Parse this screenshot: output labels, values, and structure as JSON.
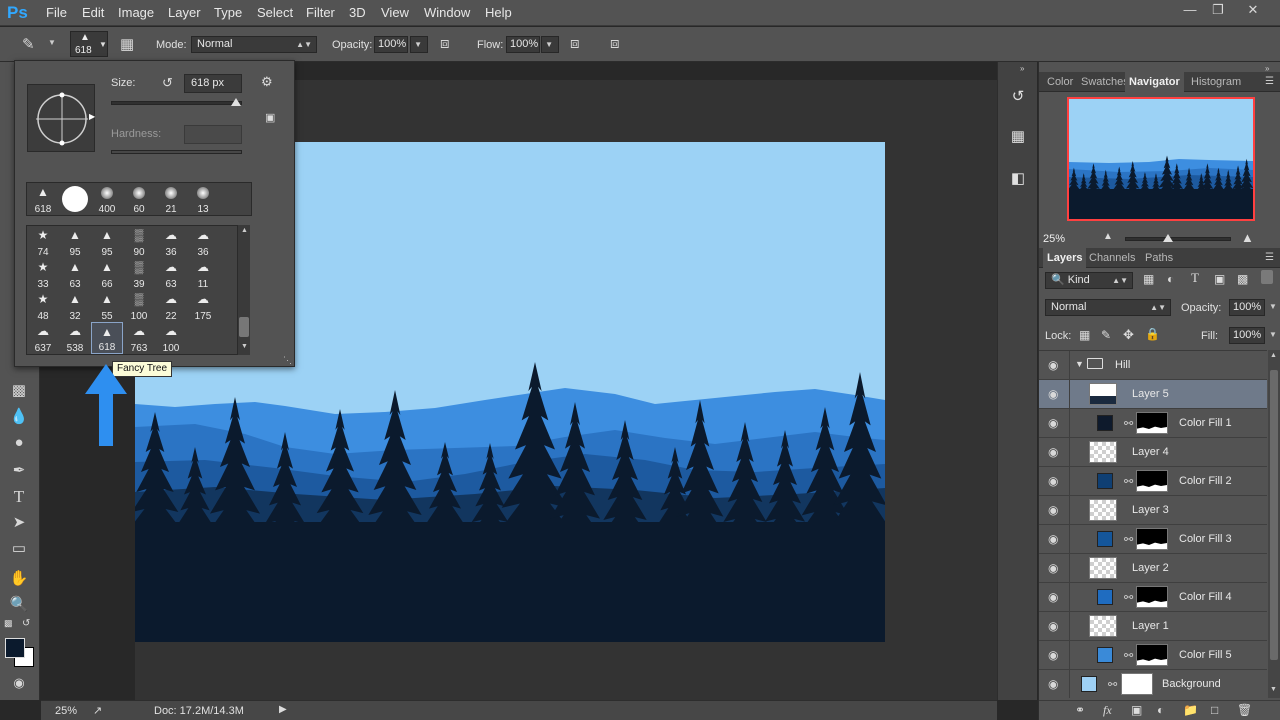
{
  "app": {
    "logo": "Ps",
    "menu": [
      "File",
      "Edit",
      "Image",
      "Layer",
      "Type",
      "Select",
      "Filter",
      "3D",
      "View",
      "Window",
      "Help"
    ],
    "window_controls": [
      "minimize",
      "restore",
      "close"
    ]
  },
  "options_bar": {
    "brush_size": "618",
    "mode_label": "Mode:",
    "mode_value": "Normal",
    "opacity_label": "Opacity:",
    "opacity_value": "100%",
    "flow_label": "Flow:",
    "flow_value": "100%"
  },
  "brush_picker": {
    "size_label": "Size:",
    "size_value": "618 px",
    "hardness_label": "Hardness:",
    "size_slider_level": 0.95,
    "recent_presets": [
      {
        "icon": "tree-brush-icon",
        "size": "618"
      },
      {
        "icon": "hard-round-brush-icon",
        "size": ""
      },
      {
        "icon": "soft-round-brush-icon",
        "size": "400"
      },
      {
        "icon": "soft-round-brush-icon",
        "size": "60"
      },
      {
        "icon": "soft-round-brush-icon",
        "size": "21"
      },
      {
        "icon": "soft-round-brush-icon",
        "size": "13"
      }
    ],
    "grid": [
      [
        "74",
        "95",
        "95",
        "90",
        "36",
        "36"
      ],
      [
        "33",
        "63",
        "66",
        "39",
        "63",
        "11"
      ],
      [
        "48",
        "32",
        "55",
        "100",
        "22",
        "175"
      ],
      [
        "637",
        "538",
        "618",
        "763",
        "100",
        ""
      ]
    ],
    "selected_cell": "618",
    "tooltip": "Fancy Tree"
  },
  "panels": {
    "top_tabs": [
      "Color",
      "Swatches",
      "Navigator",
      "Histogram"
    ],
    "active_top_tab": "Navigator",
    "navigator_zoom": "25%",
    "layer_tabs": [
      "Layers",
      "Channels",
      "Paths"
    ],
    "active_layer_tab": "Layers",
    "filter_kind": "Kind",
    "blend_mode": "Normal",
    "opacity_label": "Opacity:",
    "opacity_value": "100%",
    "lock_label": "Lock:",
    "fill_label": "Fill:",
    "fill_value": "100%"
  },
  "layers": [
    {
      "name": "Hill",
      "type": "group"
    },
    {
      "name": "Layer 5",
      "type": "layer",
      "selected": true
    },
    {
      "name": "Color Fill 1",
      "type": "fill",
      "color": "#0e1a2c"
    },
    {
      "name": "Layer 4",
      "type": "layer"
    },
    {
      "name": "Color Fill 2",
      "type": "fill",
      "color": "#0f3f73"
    },
    {
      "name": "Layer 3",
      "type": "layer"
    },
    {
      "name": "Color Fill 3",
      "type": "fill",
      "color": "#15569a"
    },
    {
      "name": "Layer 2",
      "type": "layer"
    },
    {
      "name": "Color Fill 4",
      "type": "fill",
      "color": "#1f6cc0"
    },
    {
      "name": "Layer 1",
      "type": "layer"
    },
    {
      "name": "Color Fill 5",
      "type": "fill",
      "color": "#3a8ad8"
    },
    {
      "name": "Background",
      "type": "background",
      "color": "#9ed0f4"
    }
  ],
  "status": {
    "zoom": "25%",
    "doc": "Doc: 17.2M/14.3M"
  },
  "colors": {
    "sky": "#9cd2f5",
    "far_mountain": "#3d8ee0",
    "mid_mountain": "#2b74c4",
    "near_mountain": "#1d5aa0",
    "dark_hill": "#12365f",
    "forest": "#0b1a2d",
    "accent_arrow": "#2e8ff0"
  }
}
